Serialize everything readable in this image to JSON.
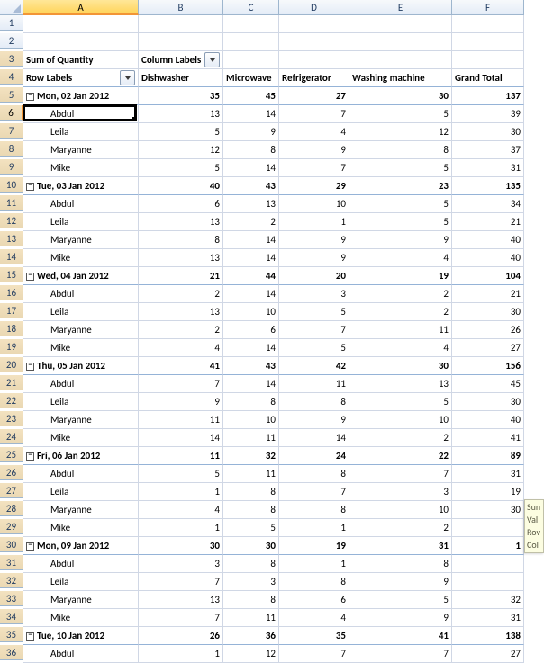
{
  "columns": [
    "",
    "A",
    "B",
    "C",
    "D",
    "E",
    "F"
  ],
  "label_sum": "Sum of Quantity",
  "label_column_labels": "Column Labels",
  "label_row_labels": "Row Labels",
  "headers": [
    "Dishwasher",
    "Microwave",
    "Refrigerator",
    "Washing machine",
    "Grand Total"
  ],
  "rows": [
    {
      "n": 1,
      "type": "blank"
    },
    {
      "n": 2,
      "type": "blank"
    },
    {
      "n": 3,
      "type": "toplabels"
    },
    {
      "n": 4,
      "type": "headers"
    },
    {
      "n": 5,
      "type": "group",
      "label": "Mon, 02 Jan 2012",
      "v": [
        35,
        45,
        27,
        30,
        137
      ]
    },
    {
      "n": 6,
      "type": "person",
      "label": "Abdul",
      "v": [
        13,
        14,
        7,
        5,
        39
      ],
      "active": true
    },
    {
      "n": 7,
      "type": "person",
      "label": "Leila",
      "v": [
        5,
        9,
        4,
        12,
        30
      ]
    },
    {
      "n": 8,
      "type": "person",
      "label": "Maryanne",
      "v": [
        12,
        8,
        9,
        8,
        37
      ]
    },
    {
      "n": 9,
      "type": "person",
      "label": "Mike",
      "v": [
        5,
        14,
        7,
        5,
        31
      ]
    },
    {
      "n": 10,
      "type": "group",
      "label": "Tue, 03 Jan 2012",
      "v": [
        40,
        43,
        29,
        23,
        135
      ]
    },
    {
      "n": 11,
      "type": "person",
      "label": "Abdul",
      "v": [
        6,
        13,
        10,
        5,
        34
      ]
    },
    {
      "n": 12,
      "type": "person",
      "label": "Leila",
      "v": [
        13,
        2,
        1,
        5,
        21
      ]
    },
    {
      "n": 13,
      "type": "person",
      "label": "Maryanne",
      "v": [
        8,
        14,
        9,
        9,
        40
      ]
    },
    {
      "n": 14,
      "type": "person",
      "label": "Mike",
      "v": [
        13,
        14,
        9,
        4,
        40
      ]
    },
    {
      "n": 15,
      "type": "group",
      "label": "Wed, 04 Jan 2012",
      "v": [
        21,
        44,
        20,
        19,
        104
      ]
    },
    {
      "n": 16,
      "type": "person",
      "label": "Abdul",
      "v": [
        2,
        14,
        3,
        2,
        21
      ]
    },
    {
      "n": 17,
      "type": "person",
      "label": "Leila",
      "v": [
        13,
        10,
        5,
        2,
        30
      ]
    },
    {
      "n": 18,
      "type": "person",
      "label": "Maryanne",
      "v": [
        2,
        6,
        7,
        11,
        26
      ]
    },
    {
      "n": 19,
      "type": "person",
      "label": "Mike",
      "v": [
        4,
        14,
        5,
        4,
        27
      ]
    },
    {
      "n": 20,
      "type": "group",
      "label": "Thu, 05 Jan 2012",
      "v": [
        41,
        43,
        42,
        30,
        156
      ]
    },
    {
      "n": 21,
      "type": "person",
      "label": "Abdul",
      "v": [
        7,
        14,
        11,
        13,
        45
      ]
    },
    {
      "n": 22,
      "type": "person",
      "label": "Leila",
      "v": [
        9,
        8,
        8,
        5,
        30
      ]
    },
    {
      "n": 23,
      "type": "person",
      "label": "Maryanne",
      "v": [
        11,
        10,
        9,
        10,
        40
      ]
    },
    {
      "n": 24,
      "type": "person",
      "label": "Mike",
      "v": [
        14,
        11,
        14,
        2,
        41
      ]
    },
    {
      "n": 25,
      "type": "group",
      "label": "Fri, 06 Jan 2012",
      "v": [
        11,
        32,
        24,
        22,
        89
      ]
    },
    {
      "n": 26,
      "type": "person",
      "label": "Abdul",
      "v": [
        5,
        11,
        8,
        7,
        31
      ]
    },
    {
      "n": 27,
      "type": "person",
      "label": "Leila",
      "v": [
        1,
        8,
        7,
        3,
        19
      ]
    },
    {
      "n": 28,
      "type": "person",
      "label": "Maryanne",
      "v": [
        4,
        8,
        8,
        10,
        30
      ]
    },
    {
      "n": 29,
      "type": "person",
      "label": "Mike",
      "v": [
        1,
        5,
        1,
        2,
        ""
      ]
    },
    {
      "n": 30,
      "type": "group",
      "label": "Mon, 09 Jan 2012",
      "v": [
        30,
        30,
        19,
        31,
        "1"
      ]
    },
    {
      "n": 31,
      "type": "person",
      "label": "Abdul",
      "v": [
        3,
        8,
        1,
        8,
        ""
      ]
    },
    {
      "n": 32,
      "type": "person",
      "label": "Leila",
      "v": [
        7,
        3,
        8,
        9,
        ""
      ]
    },
    {
      "n": 33,
      "type": "person",
      "label": "Maryanne",
      "v": [
        13,
        8,
        6,
        5,
        32
      ]
    },
    {
      "n": 34,
      "type": "person",
      "label": "Mike",
      "v": [
        7,
        11,
        4,
        9,
        31
      ]
    },
    {
      "n": 35,
      "type": "group",
      "label": "Tue, 10 Jan 2012",
      "v": [
        26,
        36,
        35,
        41,
        138
      ]
    },
    {
      "n": 36,
      "type": "person",
      "label": "Abdul",
      "v": [
        1,
        12,
        7,
        7,
        27
      ]
    }
  ],
  "tooltip": [
    "Sun",
    "Val",
    "Rov",
    "Col"
  ],
  "chart_data": {
    "type": "table",
    "title": "Sum of Quantity",
    "row_dimension": "Row Labels",
    "column_dimension": "Column Labels",
    "columns": [
      "Dishwasher",
      "Microwave",
      "Refrigerator",
      "Washing machine",
      "Grand Total"
    ],
    "rows": [
      {
        "group": "Mon, 02 Jan 2012",
        "totals": [
          35,
          45,
          27,
          30,
          137
        ],
        "children": [
          {
            "label": "Abdul",
            "values": [
              13,
              14,
              7,
              5,
              39
            ]
          },
          {
            "label": "Leila",
            "values": [
              5,
              9,
              4,
              12,
              30
            ]
          },
          {
            "label": "Maryanne",
            "values": [
              12,
              8,
              9,
              8,
              37
            ]
          },
          {
            "label": "Mike",
            "values": [
              5,
              14,
              7,
              5,
              31
            ]
          }
        ]
      },
      {
        "group": "Tue, 03 Jan 2012",
        "totals": [
          40,
          43,
          29,
          23,
          135
        ],
        "children": [
          {
            "label": "Abdul",
            "values": [
              6,
              13,
              10,
              5,
              34
            ]
          },
          {
            "label": "Leila",
            "values": [
              13,
              2,
              1,
              5,
              21
            ]
          },
          {
            "label": "Maryanne",
            "values": [
              8,
              14,
              9,
              9,
              40
            ]
          },
          {
            "label": "Mike",
            "values": [
              13,
              14,
              9,
              4,
              40
            ]
          }
        ]
      },
      {
        "group": "Wed, 04 Jan 2012",
        "totals": [
          21,
          44,
          20,
          19,
          104
        ],
        "children": [
          {
            "label": "Abdul",
            "values": [
              2,
              14,
              3,
              2,
              21
            ]
          },
          {
            "label": "Leila",
            "values": [
              13,
              10,
              5,
              2,
              30
            ]
          },
          {
            "label": "Maryanne",
            "values": [
              2,
              6,
              7,
              11,
              26
            ]
          },
          {
            "label": "Mike",
            "values": [
              4,
              14,
              5,
              4,
              27
            ]
          }
        ]
      },
      {
        "group": "Thu, 05 Jan 2012",
        "totals": [
          41,
          43,
          42,
          30,
          156
        ],
        "children": [
          {
            "label": "Abdul",
            "values": [
              7,
              14,
              11,
              13,
              45
            ]
          },
          {
            "label": "Leila",
            "values": [
              9,
              8,
              8,
              5,
              30
            ]
          },
          {
            "label": "Maryanne",
            "values": [
              11,
              10,
              9,
              10,
              40
            ]
          },
          {
            "label": "Mike",
            "values": [
              14,
              11,
              14,
              2,
              41
            ]
          }
        ]
      },
      {
        "group": "Fri, 06 Jan 2012",
        "totals": [
          11,
          32,
          24,
          22,
          89
        ],
        "children": [
          {
            "label": "Abdul",
            "values": [
              5,
              11,
              8,
              7,
              31
            ]
          },
          {
            "label": "Leila",
            "values": [
              1,
              8,
              7,
              3,
              19
            ]
          },
          {
            "label": "Maryanne",
            "values": [
              4,
              8,
              8,
              10,
              30
            ]
          },
          {
            "label": "Mike",
            "values": [
              1,
              5,
              1,
              2,
              null
            ]
          }
        ]
      },
      {
        "group": "Mon, 09 Jan 2012",
        "totals": [
          30,
          30,
          19,
          31,
          null
        ],
        "children": [
          {
            "label": "Abdul",
            "values": [
              3,
              8,
              1,
              8,
              null
            ]
          },
          {
            "label": "Leila",
            "values": [
              7,
              3,
              8,
              9,
              null
            ]
          },
          {
            "label": "Maryanne",
            "values": [
              13,
              8,
              6,
              5,
              32
            ]
          },
          {
            "label": "Mike",
            "values": [
              7,
              11,
              4,
              9,
              31
            ]
          }
        ]
      },
      {
        "group": "Tue, 10 Jan 2012",
        "totals": [
          26,
          36,
          35,
          41,
          138
        ],
        "children": [
          {
            "label": "Abdul",
            "values": [
              1,
              12,
              7,
              7,
              27
            ]
          }
        ]
      }
    ]
  }
}
